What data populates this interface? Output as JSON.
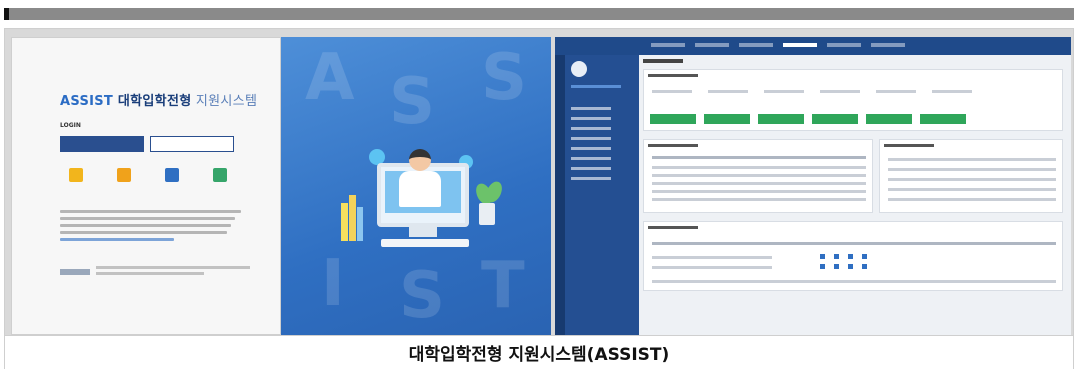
{
  "caption": "대학입학전형 지원시스템(ASSIST)",
  "login": {
    "brand": "ASSIST",
    "title_main": " 대학입학전형",
    "title_sub": " 지원시스템",
    "login_label": "LOGIN"
  },
  "hero": {
    "letters": [
      "A",
      "S",
      "S",
      "I",
      "S",
      "T"
    ]
  },
  "colors": {
    "header_blue": "#1f4a8a",
    "hero_blue": "#2f6fc2",
    "action_green": "#2fa65a"
  }
}
